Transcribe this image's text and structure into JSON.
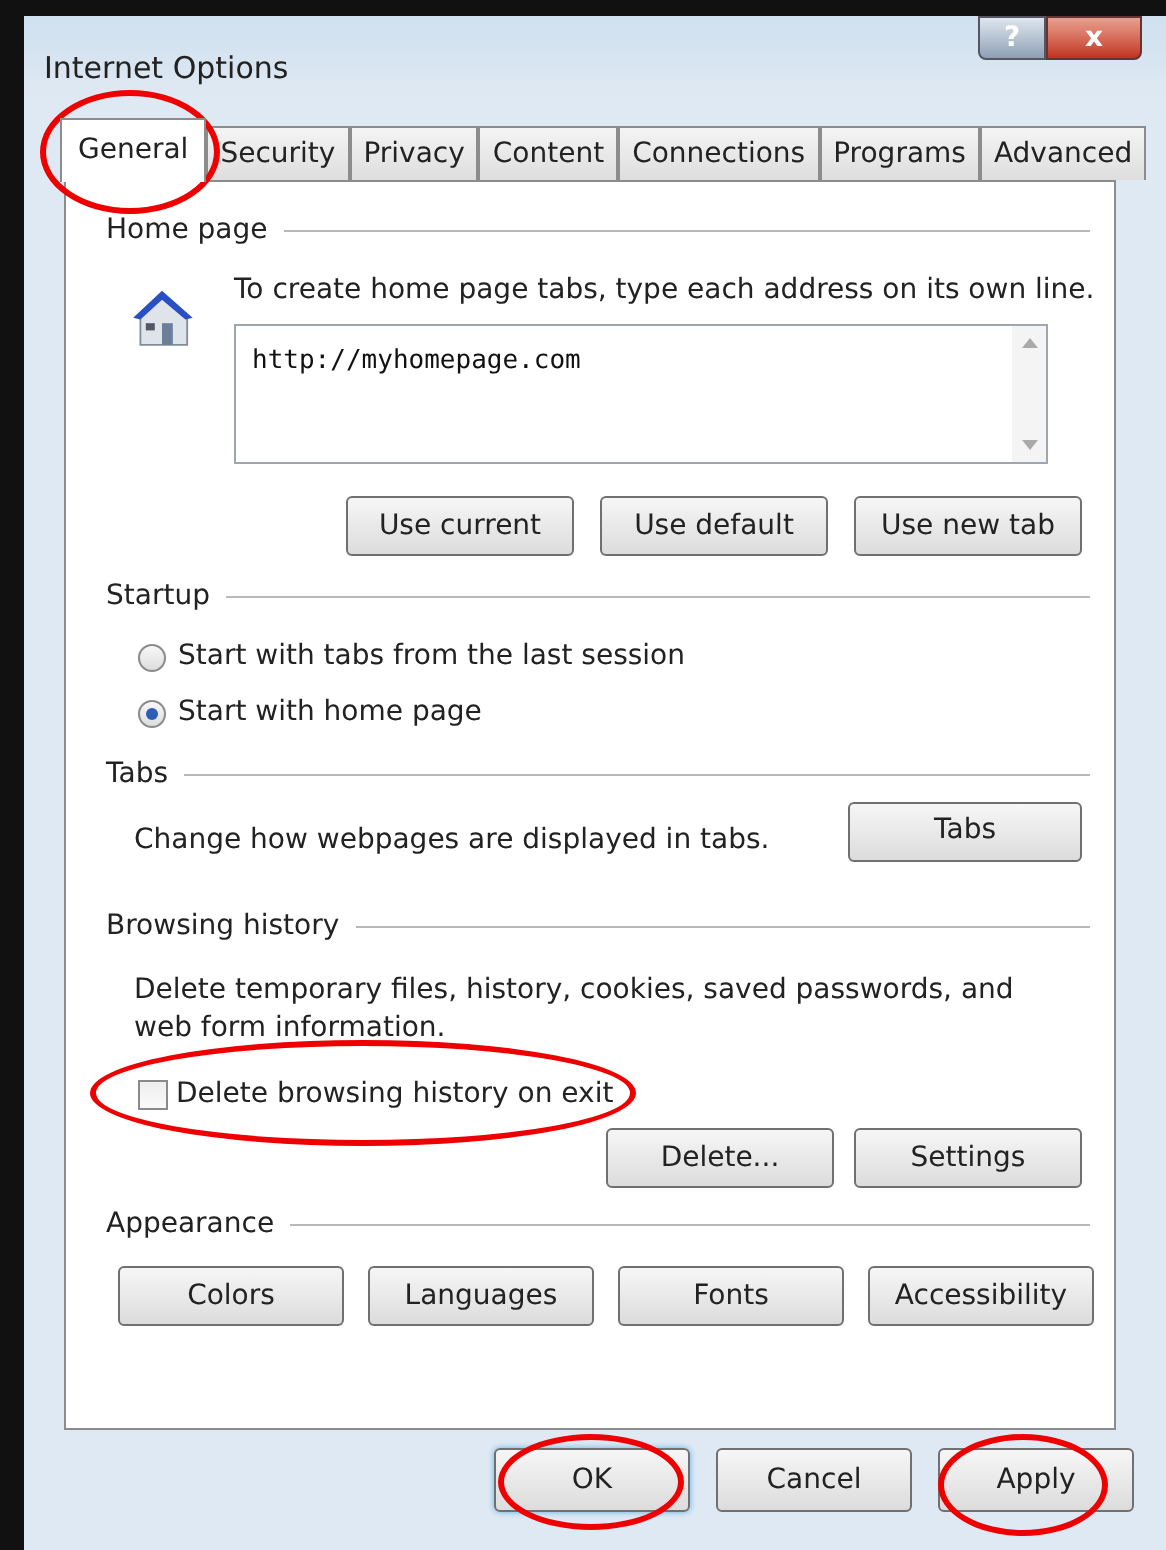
{
  "window": {
    "title": "Internet Options",
    "controls": [
      "?",
      "x"
    ]
  },
  "tabs": [
    {
      "label": "General",
      "selected": true
    },
    {
      "label": "Security",
      "selected": false
    },
    {
      "label": "Privacy",
      "selected": false
    },
    {
      "label": "Content",
      "selected": false
    },
    {
      "label": "Connections",
      "selected": false
    },
    {
      "label": "Programs",
      "selected": false
    },
    {
      "label": "Advanced",
      "selected": false
    }
  ],
  "home_page": {
    "heading": "Home page",
    "instruction": "To create home page tabs, type each address on its own line.",
    "address": "http://myhomepage.com",
    "buttons": [
      "Use current",
      "Use default",
      "Use new tab"
    ]
  },
  "startup": {
    "heading": "Startup",
    "options": [
      {
        "label": "Start with tabs from the last session",
        "selected": false
      },
      {
        "label": "Start with home page",
        "selected": true
      }
    ]
  },
  "tabs_section": {
    "heading": "Tabs",
    "description": "Change how webpages are displayed in tabs.",
    "button": "Tabs"
  },
  "browsing_history": {
    "heading": "Browsing history",
    "description": "Delete temporary files, history, cookies, saved passwords, and web form information.",
    "checkbox": {
      "label": "Delete browsing history on exit",
      "checked": false
    },
    "buttons": [
      "Delete...",
      "Settings"
    ]
  },
  "appearance": {
    "heading": "Appearance",
    "buttons": [
      "Colors",
      "Languages",
      "Fonts",
      "Accessibility"
    ]
  },
  "dialog_buttons": [
    {
      "label": "OK",
      "default": true
    },
    {
      "label": "Cancel",
      "default": false
    },
    {
      "label": "Apply",
      "default": false
    }
  ]
}
